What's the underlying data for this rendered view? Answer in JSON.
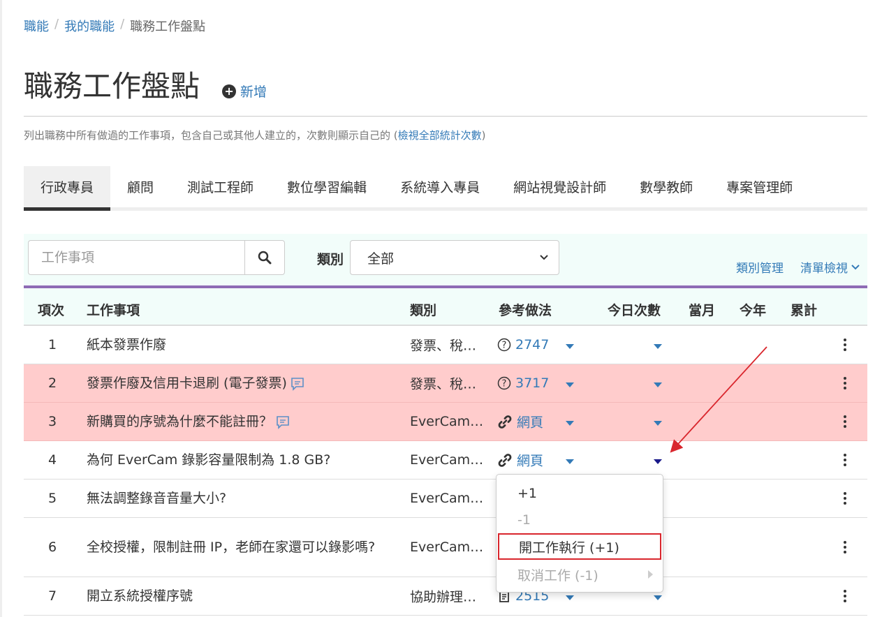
{
  "breadcrumb": {
    "items": [
      "職能",
      "我的職能"
    ],
    "separator": "/",
    "current": "職務工作盤點"
  },
  "page": {
    "title": "職務工作盤點",
    "add_label": "新增",
    "description": "列出職務中所有做過的工作事項，包含自己或其他人建立的，次數則顯示自己的 (",
    "description_link": "檢視全部統計次數",
    "description_end": ")"
  },
  "tabs": [
    "行政專員",
    "顧問",
    "測試工程師",
    "數位學習編輯",
    "系統導入專員",
    "網站視覺設計師",
    "數學教師",
    "專案管理師"
  ],
  "toolbar": {
    "search_placeholder": "工作事項",
    "category_label": "類別",
    "category_value": "全部",
    "category_manage": "類別管理",
    "list_view": "清單檢視"
  },
  "table": {
    "headers": {
      "no": "項次",
      "name": "工作事項",
      "category": "類別",
      "ref": "參考做法",
      "today": "今日次數",
      "month": "當月",
      "year": "今年",
      "total": "累計"
    },
    "rows": [
      {
        "no": "1",
        "name": "紙本發票作廢",
        "category": "發票、稅…",
        "ref": "2747",
        "ref_icon": "question-icon"
      },
      {
        "no": "2",
        "name": "發票作廢及信用卡退刷 (電子發票)",
        "category": "發票、稅…",
        "ref": "3717",
        "ref_icon": "question-icon"
      },
      {
        "no": "3",
        "name": "新購買的序號為什麼不能註冊？",
        "category": "EverCam…",
        "ref": "網頁",
        "ref_icon": "link-icon"
      },
      {
        "no": "4",
        "name": "為何 EverCam 錄影容量限制為 1.8 GB?",
        "category": "EverCam…",
        "ref": "網頁",
        "ref_icon": "link-icon"
      },
      {
        "no": "5",
        "name": "無法調整錄音音量大小?",
        "category": "EverCam…"
      },
      {
        "no": "6",
        "name": "全校授權，限制註冊 IP，老師在家還可以錄影嗎?",
        "category": "EverCam…"
      },
      {
        "no": "7",
        "name": "開立系統授權序號",
        "category": "協助辦理…",
        "ref": "2515",
        "ref_icon": "document-icon"
      }
    ]
  },
  "dropdown": {
    "items": [
      "+1",
      "-1",
      "開工作執行 (+1)",
      "取消工作 (-1)"
    ]
  },
  "colors": {
    "accent": "#337ab7",
    "highlight_row": "#ffcccc",
    "header_bg": "#f2fdfa",
    "header_border": "#8e6bb5",
    "annotation": "#d9262d"
  }
}
